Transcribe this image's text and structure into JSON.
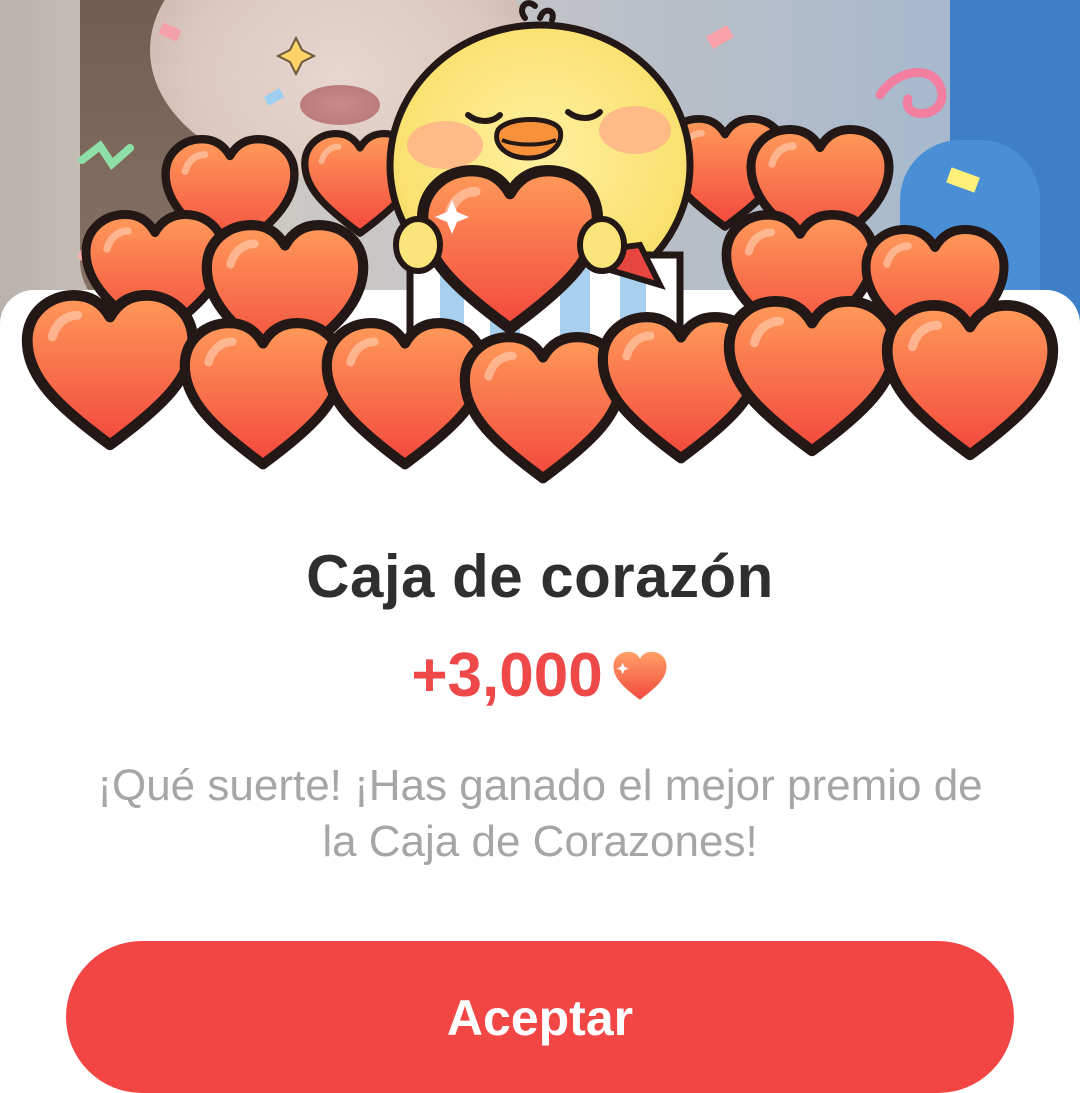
{
  "dialog": {
    "title": "Caja de corazón",
    "reward_amount": "+3,000",
    "reward_icon": "heart-icon",
    "message": "¡Qué suerte! ¡Has ganado el mejor premio de la Caja de Corazones!",
    "accept_label": "Aceptar"
  },
  "colors": {
    "accent": "#f24645",
    "reward_text": "#ef4848",
    "title_text": "#2f2f2f",
    "message_text": "#a6a6a6",
    "heart_fill": "#f5663f",
    "chick_yellow": "#fbe47a"
  },
  "illustration": {
    "icons": [
      "chick-mascot-icon",
      "heart-pile-icon",
      "gift-box-icon",
      "confetti-icon"
    ]
  }
}
